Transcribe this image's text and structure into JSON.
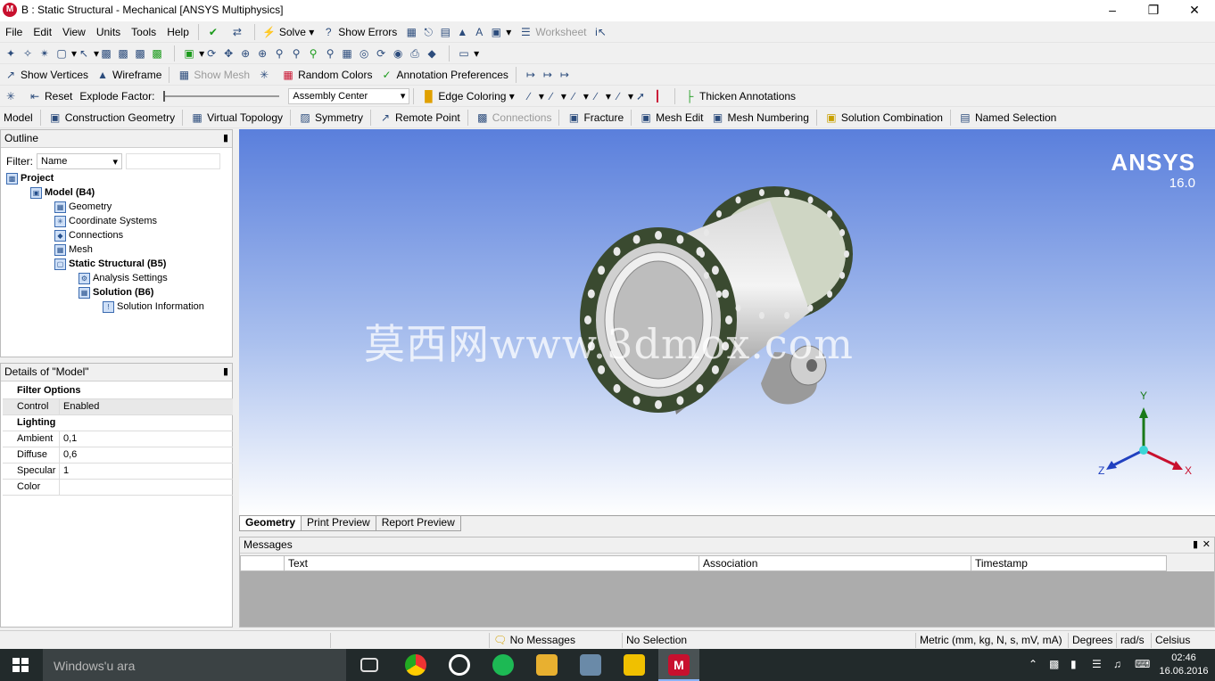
{
  "title": "B : Static Structural - Mechanical [ANSYS Multiphysics]",
  "menu": [
    "File",
    "Edit",
    "View",
    "Units",
    "Tools",
    "Help"
  ],
  "toolbar1": {
    "solve": "Solve",
    "show_errors": "Show Errors",
    "worksheet": "Worksheet"
  },
  "toolbar2": {
    "show_vertices": "Show Vertices",
    "wireframe": "Wireframe",
    "show_mesh": "Show Mesh",
    "random_colors": "Random Colors",
    "annotation_preferences": "Annotation Preferences"
  },
  "toolbar3": {
    "reset": "Reset",
    "explode_factor": "Explode Factor:",
    "assembly_center": "Assembly Center",
    "edge_coloring": "Edge Coloring",
    "thicken_annotations": "Thicken Annotations"
  },
  "context": {
    "model": "Model",
    "construction_geometry": "Construction Geometry",
    "virtual_topology": "Virtual Topology",
    "symmetry": "Symmetry",
    "remote_point": "Remote Point",
    "connections": "Connections",
    "fracture": "Fracture",
    "mesh_edit": "Mesh Edit",
    "mesh_numbering": "Mesh Numbering",
    "solution_combination": "Solution Combination",
    "named_selection": "Named Selection"
  },
  "outline": {
    "title": "Outline",
    "filter_label": "Filter:",
    "filter_value": "Name",
    "tree": [
      {
        "label": "Project",
        "level": 0,
        "bold": true
      },
      {
        "label": "Model (B4)",
        "level": 1,
        "bold": true
      },
      {
        "label": "Geometry",
        "level": 2,
        "bold": false
      },
      {
        "label": "Coordinate Systems",
        "level": 2,
        "bold": false
      },
      {
        "label": "Connections",
        "level": 2,
        "bold": false
      },
      {
        "label": "Mesh",
        "level": 2,
        "bold": false
      },
      {
        "label": "Static Structural (B5)",
        "level": 2,
        "bold": true
      },
      {
        "label": "Analysis Settings",
        "level": 3,
        "bold": false
      },
      {
        "label": "Solution (B6)",
        "level": 3,
        "bold": true
      },
      {
        "label": "Solution Information",
        "level": 4,
        "bold": false
      }
    ]
  },
  "details": {
    "title": "Details of \"Model\"",
    "groups": [
      {
        "name": "Filter Options",
        "rows": [
          {
            "k": "Control",
            "v": "Enabled"
          }
        ]
      },
      {
        "name": "Lighting",
        "rows": [
          {
            "k": "Ambient",
            "v": "0,1"
          },
          {
            "k": "Diffuse",
            "v": "0,6"
          },
          {
            "k": "Specular",
            "v": "1"
          },
          {
            "k": "Color",
            "v": ""
          }
        ]
      }
    ]
  },
  "viewport": {
    "brand": "ANSYS",
    "version": "16.0",
    "watermark": "莫西网www.3dmox.com",
    "axes": {
      "y": "Y",
      "x": "X",
      "z": "Z"
    }
  },
  "tabs": [
    "Geometry",
    "Print Preview",
    "Report Preview"
  ],
  "messages": {
    "title": "Messages",
    "columns": [
      "Text",
      "Association",
      "Timestamp"
    ]
  },
  "status": {
    "messages": "No Messages",
    "selection": "No Selection",
    "units": "Metric (mm, kg, N, s, mV, mA)",
    "angle": "Degrees",
    "rate": "rad/s",
    "temp": "Celsius"
  },
  "taskbar": {
    "search": "Windows'u ara",
    "time": "02:46",
    "date": "16.06.2016"
  }
}
